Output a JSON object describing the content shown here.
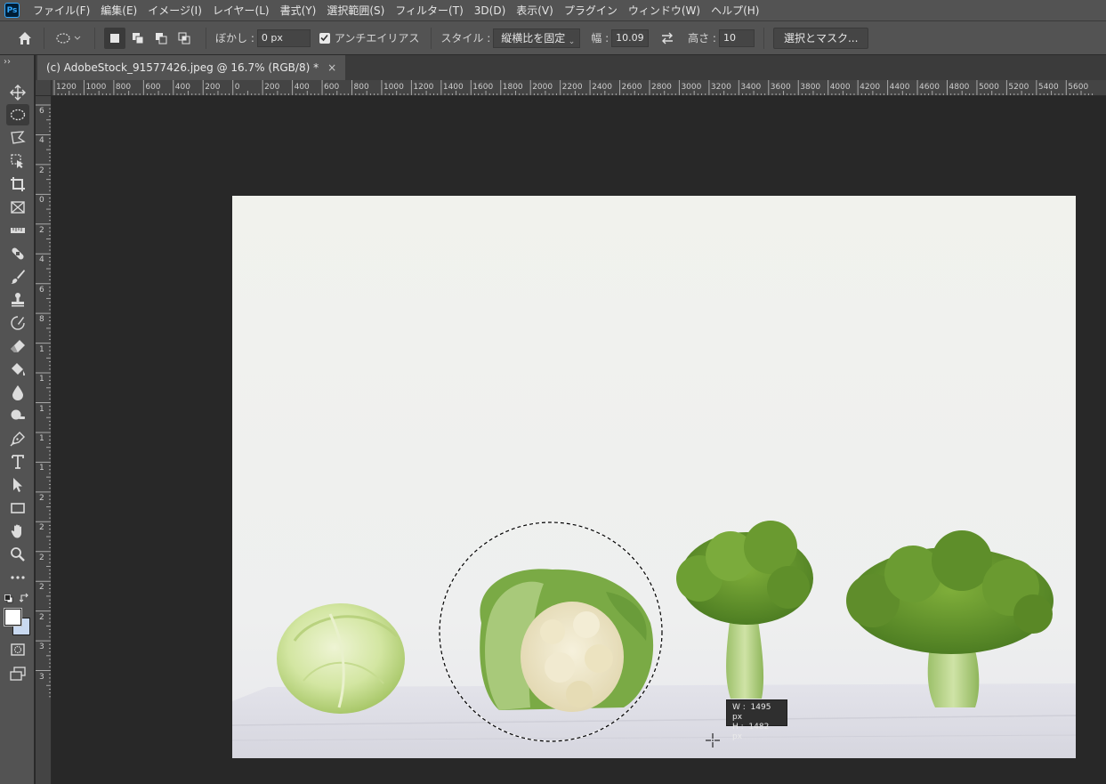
{
  "app": {
    "logo_text": "Ps"
  },
  "menu": [
    "ファイル(F)",
    "編集(E)",
    "イメージ(I)",
    "レイヤー(L)",
    "書式(Y)",
    "選択範囲(S)",
    "フィルター(T)",
    "3D(D)",
    "表示(V)",
    "プラグイン",
    "ウィンドウ(W)",
    "ヘルプ(H)"
  ],
  "options": {
    "feather_label": "ぼかし :",
    "feather_value": "0 px",
    "antialias_label": "アンチエイリアス",
    "antialias_checked": true,
    "style_label": "スタイル :",
    "style_value": "縦横比を固定",
    "width_label": "幅 :",
    "width_value": "10.09",
    "height_label": "高さ :",
    "height_value": "10",
    "select_mask_label": "選択とマスク..."
  },
  "document": {
    "tab_title": "(c) AdobeStock_91577426.jpeg @ 16.7% (RGB/8) *",
    "zoom": "16.7%"
  },
  "ruler_h_labels": [
    "1200",
    "1000",
    "800",
    "600",
    "400",
    "200",
    "0",
    "200",
    "400",
    "600",
    "800",
    "1000",
    "1200",
    "1400",
    "1600",
    "1800",
    "2000",
    "2200",
    "2400",
    "2600",
    "2800",
    "3000",
    "3200",
    "3400",
    "3600",
    "3800",
    "4000",
    "4200",
    "4400",
    "4600",
    "4800",
    "5000",
    "5200",
    "5400",
    "5600"
  ],
  "ruler_v_labels": [
    "6",
    "4",
    "2",
    "0",
    "2",
    "4",
    "6",
    "8",
    "1",
    "1",
    "1",
    "1",
    "1",
    "2",
    "2",
    "2",
    "2",
    "2",
    "3",
    "3"
  ],
  "selection_info": {
    "w_label": "W :",
    "w_value": "1495 px",
    "h_label": "H :",
    "h_value": "1482 px"
  },
  "tools": [
    "move-tool",
    "elliptical-marquee-tool",
    "lasso-tool",
    "object-selection-tool",
    "crop-tool",
    "frame-tool",
    "ruler-tool",
    "healing-brush-tool",
    "brush-tool",
    "clone-stamp-tool",
    "history-brush-tool",
    "eraser-tool",
    "paint-bucket-tool",
    "blur-tool",
    "dodge-tool",
    "pen-tool",
    "type-tool",
    "path-selection-tool",
    "rectangle-tool",
    "hand-tool",
    "zoom-tool",
    "more-tools"
  ],
  "colors": {
    "foreground": "#ffffff",
    "background": "#c9d9f0",
    "ui_panel": "#535353",
    "workspace": "#282828"
  }
}
